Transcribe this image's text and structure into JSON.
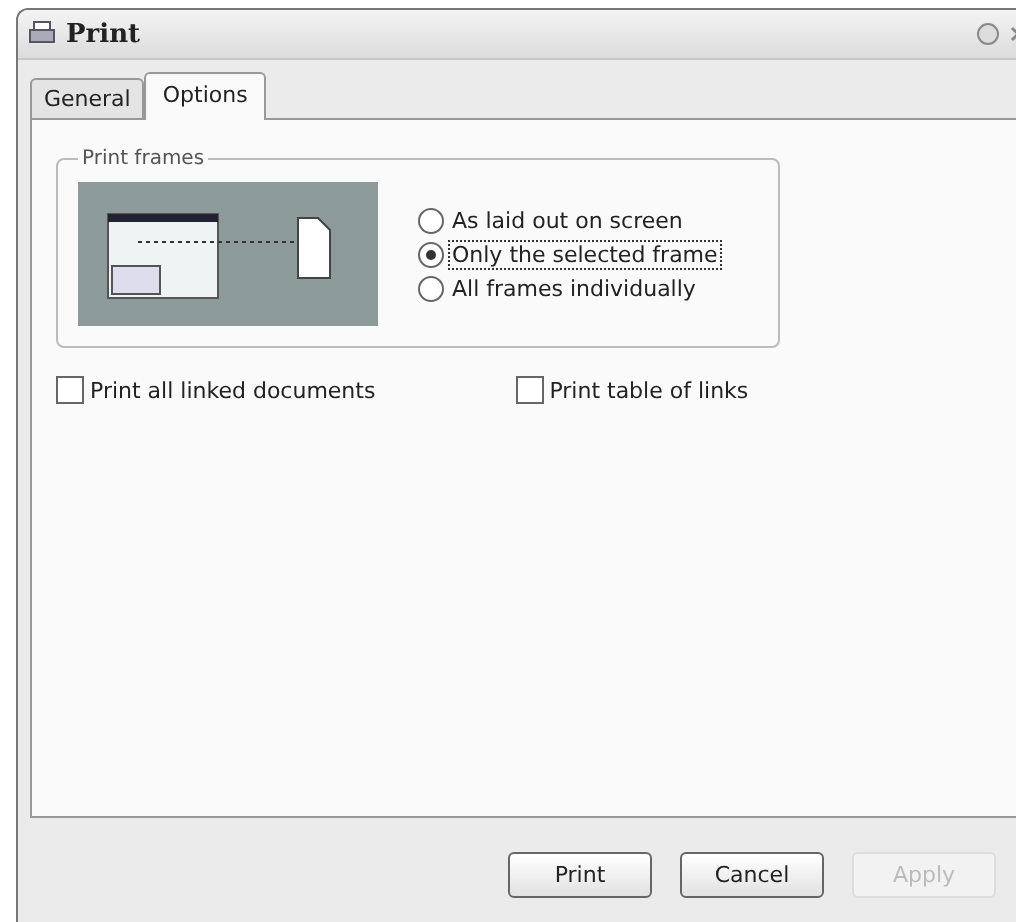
{
  "window": {
    "title": "Print"
  },
  "tabs": [
    {
      "label": "General",
      "selected": false
    },
    {
      "label": "Options",
      "selected": true
    }
  ],
  "print_frames": {
    "title": "Print frames",
    "options": [
      {
        "label": "As laid out on screen",
        "selected": false
      },
      {
        "label": "Only the selected frame",
        "selected": true
      },
      {
        "label": "All frames individually",
        "selected": false
      }
    ]
  },
  "checkboxes": [
    {
      "label": "Print all linked documents",
      "checked": false
    },
    {
      "label": "Print table of links",
      "checked": false
    }
  ],
  "buttons": [
    {
      "label": "Print",
      "disabled": false
    },
    {
      "label": "Cancel",
      "disabled": false
    },
    {
      "label": "Apply",
      "disabled": true
    }
  ]
}
